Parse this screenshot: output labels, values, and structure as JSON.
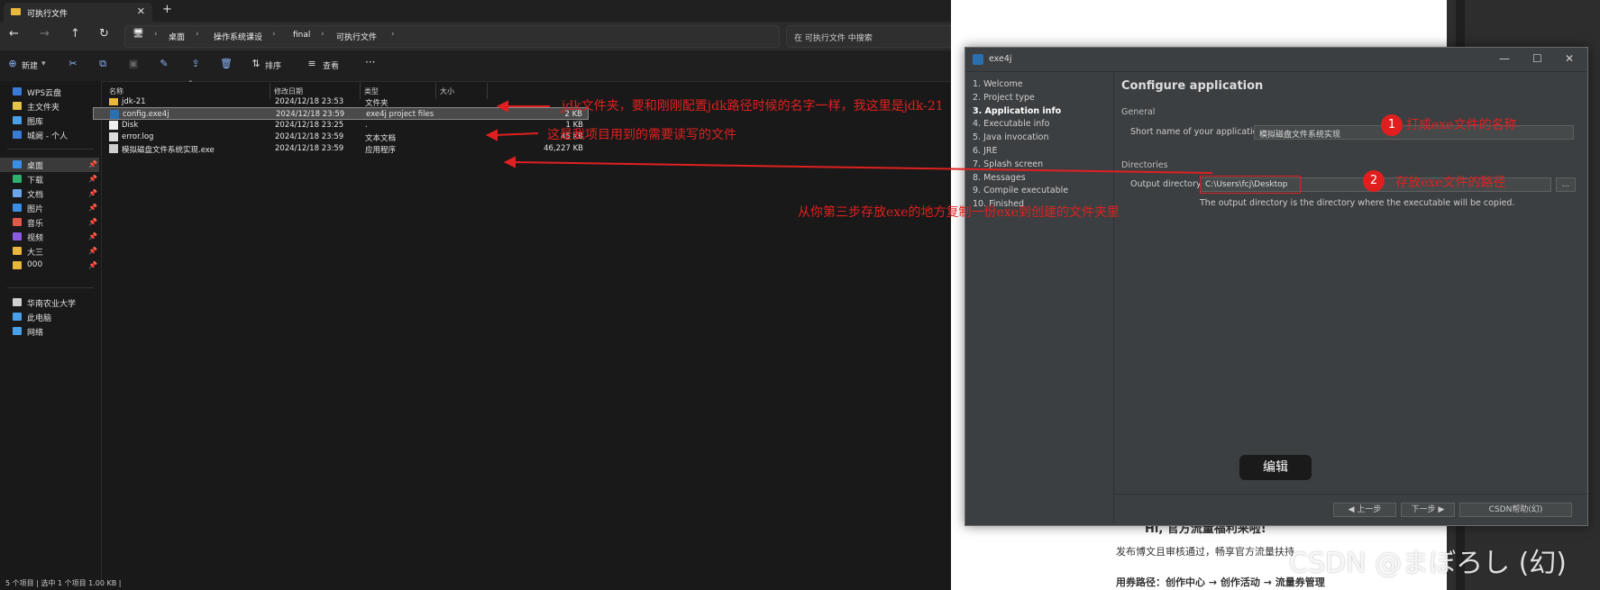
{
  "explorer": {
    "tab_title": "可执行文件",
    "new_tab": "+",
    "tab_close": "✕",
    "nav": {
      "back": "←",
      "forward": "→",
      "up": "↑",
      "refresh": "↻",
      "expand": "›"
    },
    "breadcrumbs": [
      "桌面",
      "操作系统课设",
      "final",
      "可执行文件"
    ],
    "search_placeholder": "在 可执行文件 中搜索",
    "commands": {
      "new": "新建",
      "sort": "排序",
      "view": "查看",
      "more": "···"
    },
    "sidebar": [
      {
        "label": "WPS云盘",
        "icon": "cloud-icon",
        "color": "#3a7bd5"
      },
      {
        "label": "主文件夹",
        "icon": "home-icon",
        "color": "#e6c34a"
      },
      {
        "label": "图库",
        "icon": "gallery-icon",
        "color": "#4aa0e6"
      },
      {
        "label": "城阙 - 个人",
        "icon": "onedrive-icon",
        "color": "#3a7bd5"
      },
      {
        "label": "桌面",
        "icon": "desktop-icon",
        "color": "#3a8ee6",
        "selected": true
      },
      {
        "label": "下载",
        "icon": "download-icon",
        "color": "#2fae6e"
      },
      {
        "label": "文档",
        "icon": "document-icon",
        "color": "#6aa6e8"
      },
      {
        "label": "图片",
        "icon": "picture-icon",
        "color": "#3a8ee6"
      },
      {
        "label": "音乐",
        "icon": "music-icon",
        "color": "#e05a4a"
      },
      {
        "label": "视频",
        "icon": "video-icon",
        "color": "#8a5ae0"
      },
      {
        "label": "大三",
        "icon": "folder-icon",
        "color": "#e8b73c"
      },
      {
        "label": "000",
        "icon": "folder-icon",
        "color": "#e8b73c"
      },
      {
        "label": "华南农业大学",
        "icon": "folder-icon",
        "color": "#cfcfcf"
      },
      {
        "label": "此电脑",
        "icon": "computer-icon",
        "color": "#4aa0e6"
      },
      {
        "label": "网络",
        "icon": "network-icon",
        "color": "#4aa0e6"
      }
    ],
    "columns": [
      "名称",
      "修改日期",
      "类型",
      "大小"
    ],
    "files": [
      {
        "name": "jdk-21",
        "date": "2024/12/18 23:53",
        "type": "文件夹",
        "size": "",
        "icon": "folder-icon"
      },
      {
        "name": "config.exe4j",
        "date": "2024/12/18 23:59",
        "type": "exe4j project files",
        "size": "2 KB",
        "icon": "exe4j-file-icon",
        "selected": true
      },
      {
        "name": "Disk",
        "date": "2024/12/18 23:25",
        "type": "",
        "size": "1 KB",
        "icon": "file-icon"
      },
      {
        "name": "error.log",
        "date": "2024/12/18 23:59",
        "type": "文本文档",
        "size": "45 KB",
        "icon": "text-file-icon"
      },
      {
        "name": "模拟磁盘文件系统实现.exe",
        "date": "2024/12/18 23:59",
        "type": "应用程序",
        "size": "46,227 KB",
        "icon": "exe-icon"
      }
    ],
    "file2_type_dot": ".",
    "status": "5 个项目  |  选中 1 个项目  1.00 KB  |"
  },
  "annotations": {
    "jdk": "jdk文件夹，要和刚刚配置jdk路径时候的名字一样，我这里是jdk-21",
    "config": "这是我项目用到的需要读写的文件",
    "exe": "从你第三步存放exe的地方复制一份exe到创建的文件夹里",
    "name": "打成exe文件的名称",
    "path": "存放exe文件的路径",
    "circle1": "1",
    "circle2": "2"
  },
  "dialog": {
    "title": "exe4j",
    "steps": [
      "1. Welcome",
      "2. Project type",
      "3. Application info",
      "4. Executable info",
      "5. Java invocation",
      "6. JRE",
      "7. Splash screen",
      "8. Messages",
      "9. Compile executable",
      "10. Finished"
    ],
    "heading": "Configure application",
    "general": "General",
    "short_name_label": "Short name of your application:",
    "short_name_value": "模拟磁盘文件系统实现",
    "directories": "Directories",
    "output_label": "Output directory:",
    "output_value": "C:\\Users\\fcj\\Desktop",
    "browse": "...",
    "hint": "The output directory is the directory where the executable will be copied.",
    "prev": "◀ 上一步",
    "next": "下一步 ▶",
    "cancel": "CSDN帮助(幻)",
    "minimize": "—",
    "maximize": "☐",
    "close": "✕"
  },
  "overlay": {
    "edit_button": "编辑",
    "web_line1": "Hi, 官方流量福利来啦!",
    "web_line2": "发布博文且审核通过，畅享官方流量扶持",
    "web_line3": "用券路径：创作中心 → 创作活动 → 流量券管理",
    "watermark": "CSDN @まぼろし (幻)"
  }
}
